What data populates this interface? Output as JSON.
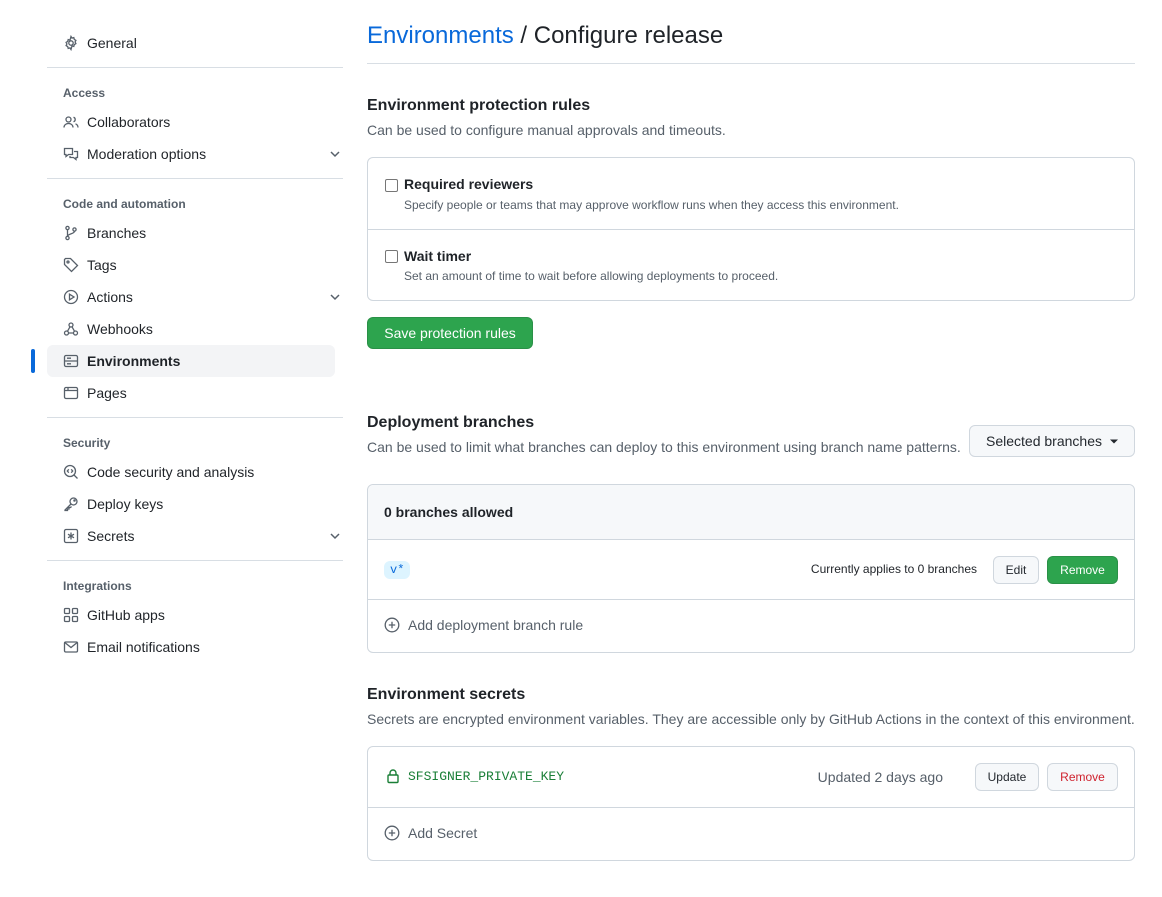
{
  "sidebar": {
    "general": "General",
    "access_heading": "Access",
    "collaborators": "Collaborators",
    "moderation": "Moderation options",
    "code_heading": "Code and automation",
    "branches": "Branches",
    "tags": "Tags",
    "actions": "Actions",
    "webhooks": "Webhooks",
    "environments": "Environments",
    "pages": "Pages",
    "security_heading": "Security",
    "code_security": "Code security and analysis",
    "deploy_keys": "Deploy keys",
    "secrets": "Secrets",
    "integrations_heading": "Integrations",
    "github_apps": "GitHub apps",
    "email_notifications": "Email notifications"
  },
  "header": {
    "breadcrumb_link": "Environments",
    "separator": " / ",
    "page": "Configure release"
  },
  "protection": {
    "heading": "Environment protection rules",
    "description": "Can be used to configure manual approvals and timeouts.",
    "rules": [
      {
        "title": "Required reviewers",
        "desc": "Specify people or teams that may approve workflow runs when they access this environment.",
        "checked": false
      },
      {
        "title": "Wait timer",
        "desc": "Set an amount of time to wait before allowing deployments to proceed.",
        "checked": false
      }
    ],
    "save_label": "Save protection rules"
  },
  "deployment": {
    "heading": "Deployment branches",
    "description": "Can be used to limit what branches can deploy to this environment using branch name patterns.",
    "dropdown_label": "Selected branches",
    "count_label": "0 branches allowed",
    "rule_pattern": "v*",
    "rule_applies": "Currently applies to 0 branches",
    "edit_label": "Edit",
    "remove_label": "Remove",
    "add_label": "Add deployment branch rule"
  },
  "secrets": {
    "heading": "Environment secrets",
    "description": "Secrets are encrypted environment variables. They are accessible only by GitHub Actions in the context of this environment.",
    "items": [
      {
        "name": "SFSIGNER_PRIVATE_KEY",
        "updated": "Updated 2 days ago"
      }
    ],
    "update_label": "Update",
    "remove_label": "Remove",
    "add_label": "Add Secret"
  },
  "colors": {
    "link": "#0969da",
    "primary_button": "#2da44e",
    "danger": "#cf222e",
    "secret_green": "#1a7f37"
  }
}
